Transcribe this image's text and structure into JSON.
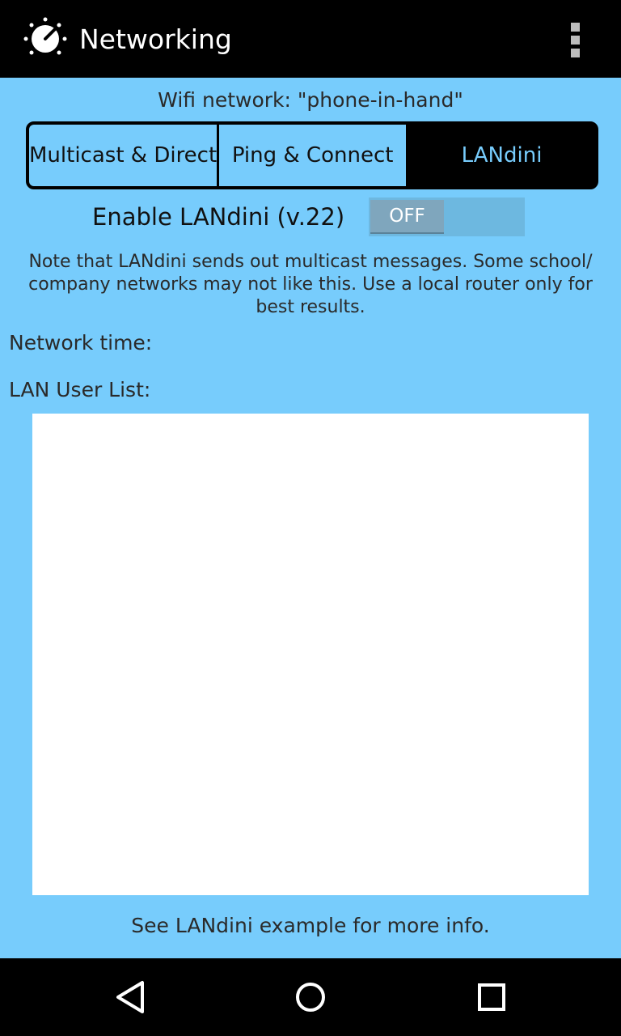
{
  "appbar": {
    "title": "Networking",
    "app_icon": "dial-knob-icon",
    "overflow_icon": "more-vert-icon"
  },
  "wifi": {
    "label": "Wifi network: \"phone-in-hand\""
  },
  "tabs": [
    {
      "label": "Multicast & Direct",
      "active": false
    },
    {
      "label": "Ping & Connect",
      "active": false
    },
    {
      "label": "LANdini",
      "active": true
    }
  ],
  "landini": {
    "enable_label": "Enable LANdini (v.22)",
    "toggle_state": "OFF",
    "note": "Note that LANdini sends out multicast messages. Some school/ company networks may not like this. Use a local router only for best results.",
    "network_time_label": "Network time:",
    "user_list_label": "LAN User List:",
    "footer": "See LANdini example for more info."
  },
  "navbar": {
    "back_icon": "back-triangle-icon",
    "home_icon": "home-circle-icon",
    "recents_icon": "recents-square-icon"
  },
  "colors": {
    "background": "#77ccfc",
    "bar": "#000000",
    "list_bg": "#ffffff"
  }
}
